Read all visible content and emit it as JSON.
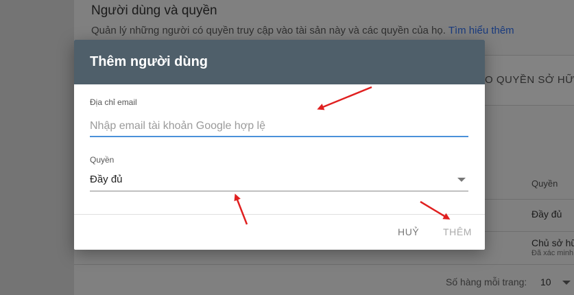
{
  "background": {
    "title": "Người dùng và quyền",
    "subtitle": "Quản lý những người có quyền truy cập vào tài sản này và các quyền của họ.",
    "learn_more": "Tìm hiểu thêm",
    "tab_label": "O QUYỀN SỞ HỮU",
    "column_header": "Quyền",
    "rows": [
      {
        "permission": "Đầy đủ"
      },
      {
        "permission": "Chủ sở hữ",
        "note": "Đã xác minh"
      }
    ],
    "footer": {
      "rows_per_page_label": "Số hàng mỗi trang:",
      "rows_per_page_value": "10"
    }
  },
  "dialog": {
    "title": "Thêm người dùng",
    "email": {
      "label": "Địa chỉ email",
      "placeholder": "Nhập email tài khoản Google hợp lệ",
      "value": ""
    },
    "role": {
      "label": "Quyền",
      "selected": "Đầy đủ"
    },
    "buttons": {
      "cancel": "HUỶ",
      "add": "THÊM"
    }
  },
  "colors": {
    "dialog_header": "#4f5f6a",
    "focus_underline": "#4a90d9",
    "annotation_arrow": "#e02020"
  }
}
